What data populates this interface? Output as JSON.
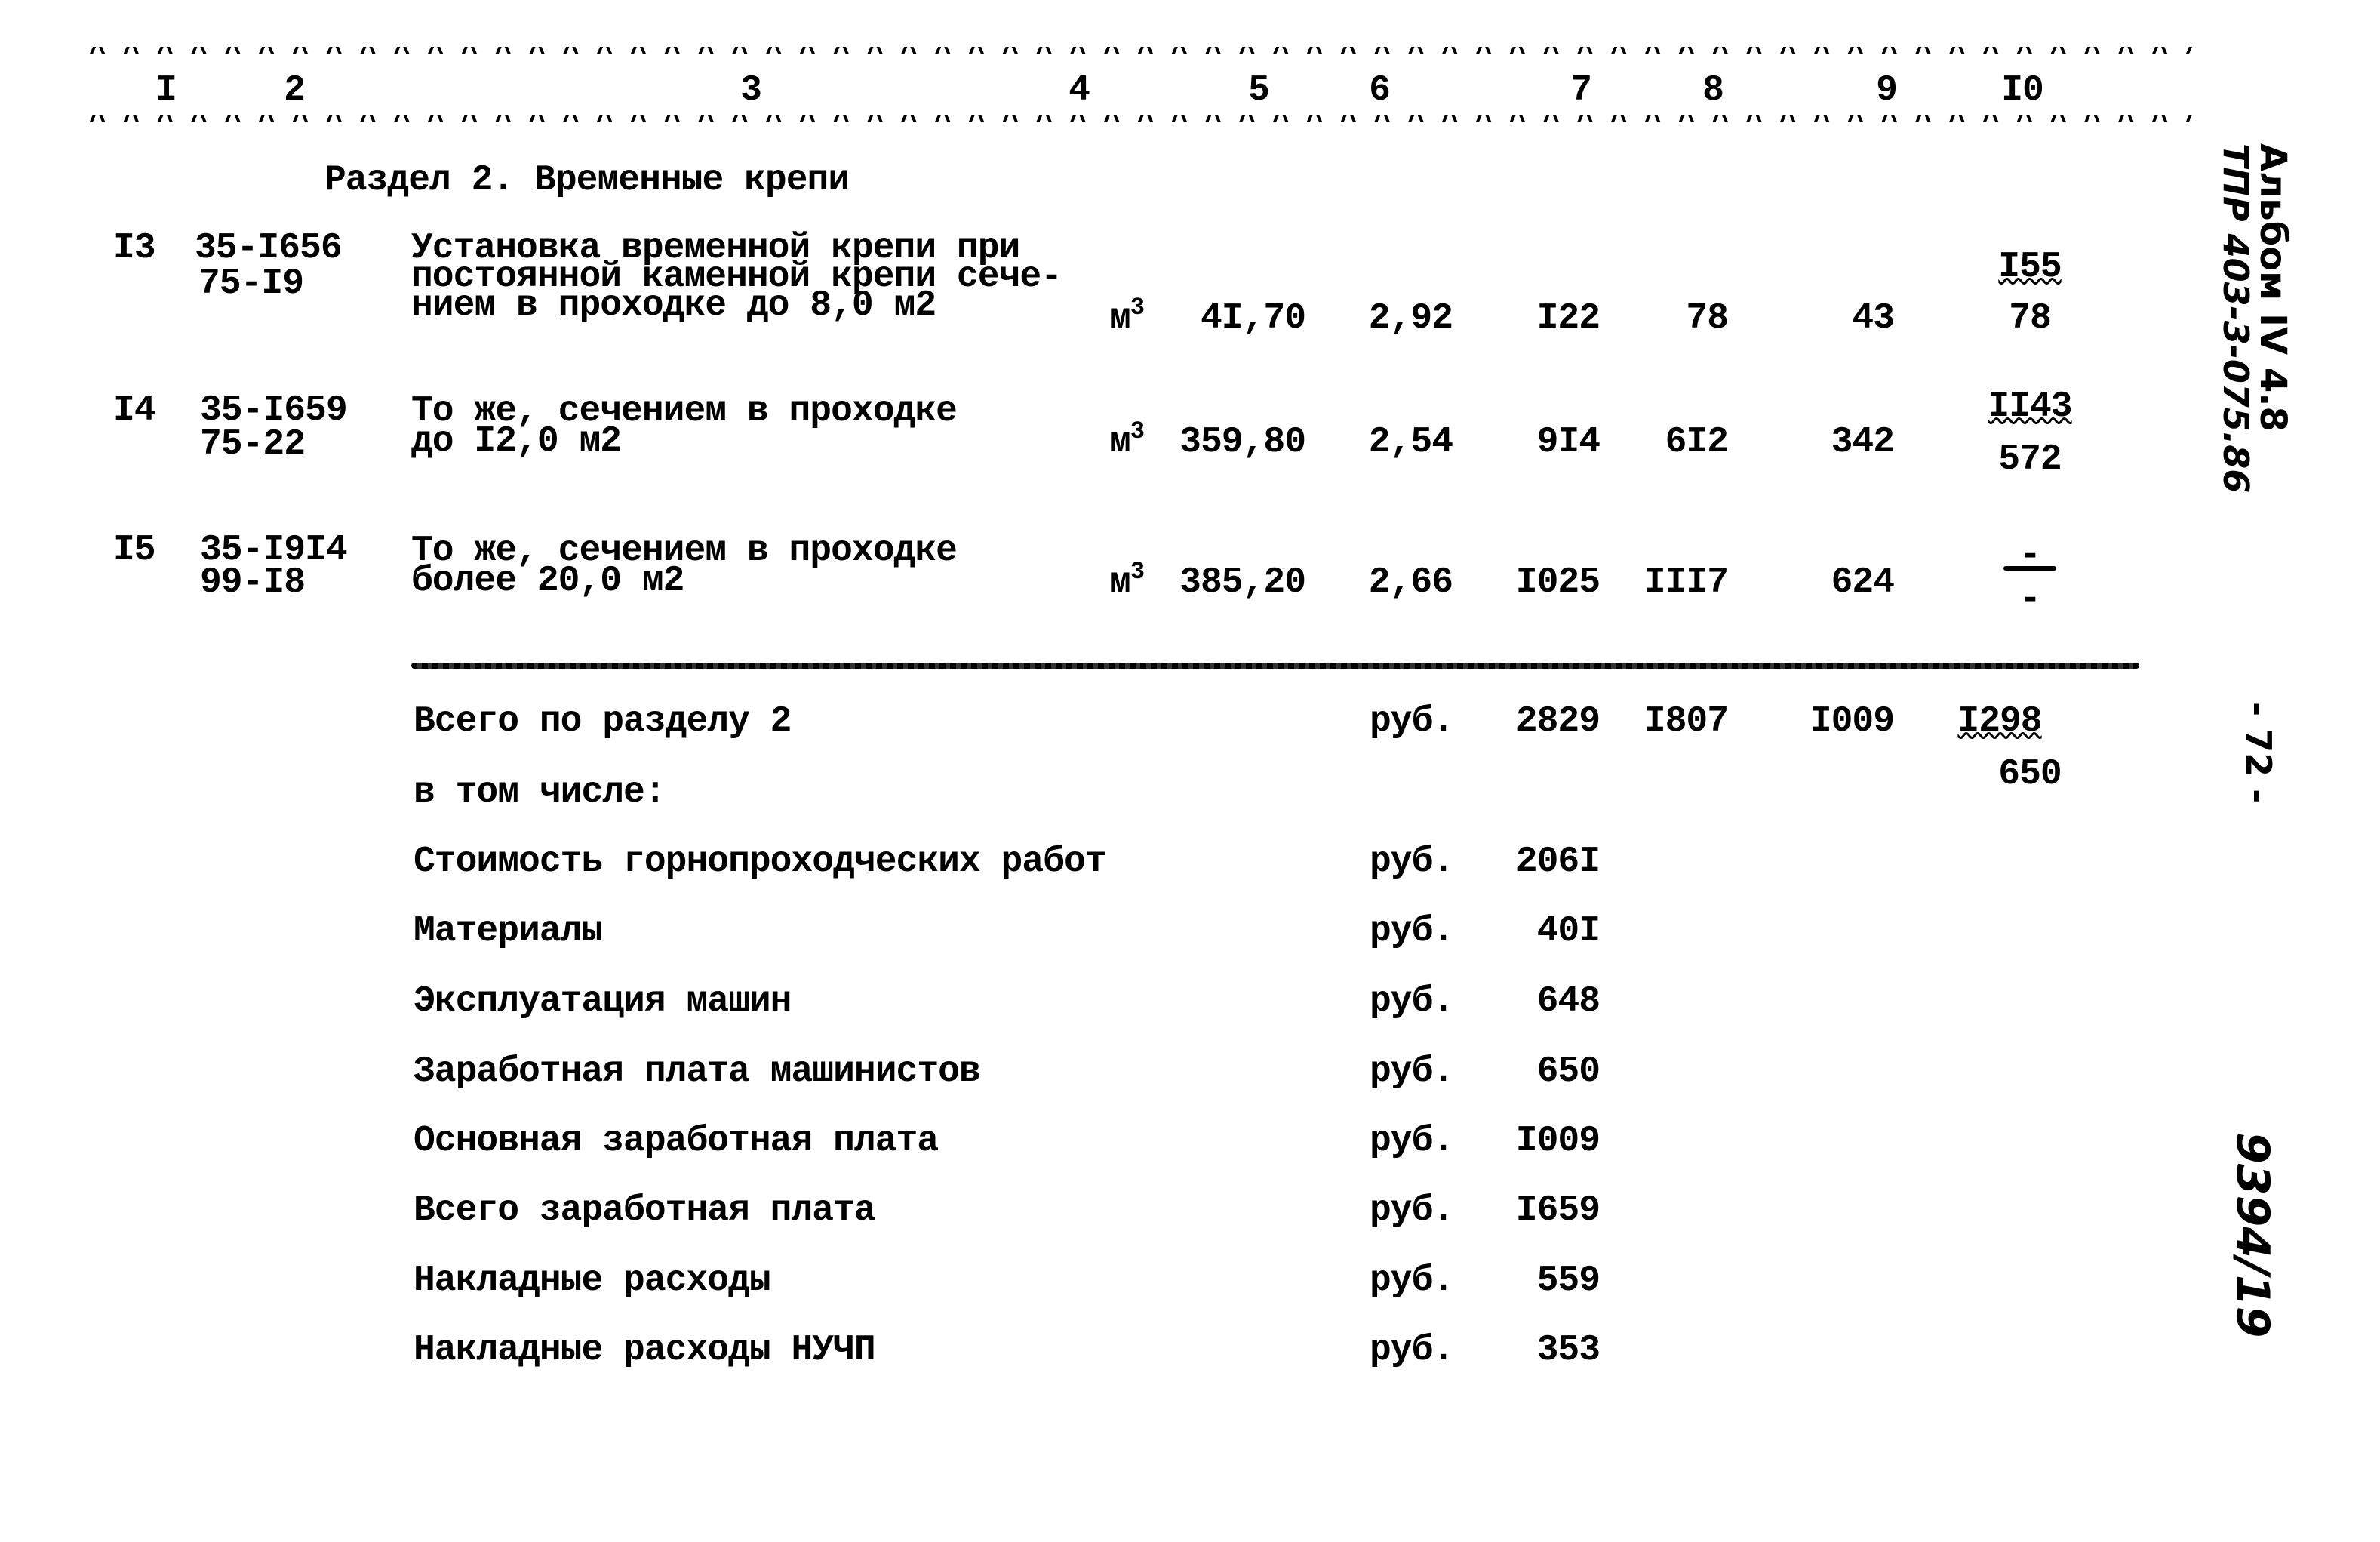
{
  "header_columns": [
    "I",
    "2",
    "3",
    "4",
    "5",
    "6",
    "7",
    "8",
    "9",
    "I0"
  ],
  "dash_rule": "^^^^^^^^^^^^^^^^^^^^^^^^^^^^^^^^^^^^^^^^^^^^^^^^^^^^^^^^^^^^^^^^^^^^^^^^^^^^^^^",
  "section_title": "Раздел 2. Временные крепи",
  "rows": [
    {
      "num": "I3",
      "code1": "35-I656",
      "code2": "75-I9",
      "desc": [
        "Установка временной крепи при",
        "постоянной каменной крепи сече-",
        "нием в проходке до 8,0 м2"
      ],
      "unit": "м",
      "unit_sup": "3",
      "qty": "4I,70",
      "c6": "2,92",
      "c7": "I22",
      "c8": "78",
      "c9": "43",
      "c10_top": "I55",
      "c10_bottom": "78"
    },
    {
      "num": "I4",
      "code1": "35-I659",
      "code2": "75-22",
      "desc": [
        "То же, сечением в проходке",
        "до I2,0 м2"
      ],
      "unit": "м",
      "unit_sup": "3",
      "qty": "359,80",
      "c6": "2,54",
      "c7": "9I4",
      "c8": "6I2",
      "c9": "342",
      "c10_top": "II43",
      "c10_bottom": "572"
    },
    {
      "num": "I5",
      "code1": "35-I9I4",
      "code2": "99-I8",
      "desc": [
        "То же, сечением в проходке",
        "более 20,0 м2"
      ],
      "unit": "м",
      "unit_sup": "3",
      "qty": "385,20",
      "c6": "2,66",
      "c7": "I025",
      "c8": "III7",
      "c9": "624",
      "c10_top": "-",
      "c10_bottom": "-"
    }
  ],
  "totals": {
    "label": "Всего по разделу 2",
    "unit": "руб.",
    "c7": "2829",
    "c8": "I807",
    "c9": "I009",
    "c10_top": "I298",
    "c10_bottom": "650",
    "including_label": "в том числе:"
  },
  "breakdown": [
    {
      "label": "Стоимость горнопроходческих работ",
      "unit": "руб.",
      "value": "206I"
    },
    {
      "label": "Материалы",
      "unit": "руб.",
      "value": "40I"
    },
    {
      "label": "Эксплуатация машин",
      "unit": "руб.",
      "value": "648"
    },
    {
      "label": "Заработная плата машинистов",
      "unit": "руб.",
      "value": "650"
    },
    {
      "label": "Основная заработная плата",
      "unit": "руб.",
      "value": "I009"
    },
    {
      "label": "Всего заработная плата",
      "unit": "руб.",
      "value": "I659"
    },
    {
      "label": "Накладные расходы",
      "unit": "руб.",
      "value": "559"
    },
    {
      "label": "Накладные расходы НУЧП",
      "unit": "руб.",
      "value": "353"
    }
  ],
  "margin": {
    "album": "Альбом IV 4.8",
    "project_code": "ТПР 403-3-075.86",
    "page_number": "- 72 -",
    "inventory": "9394/19"
  }
}
